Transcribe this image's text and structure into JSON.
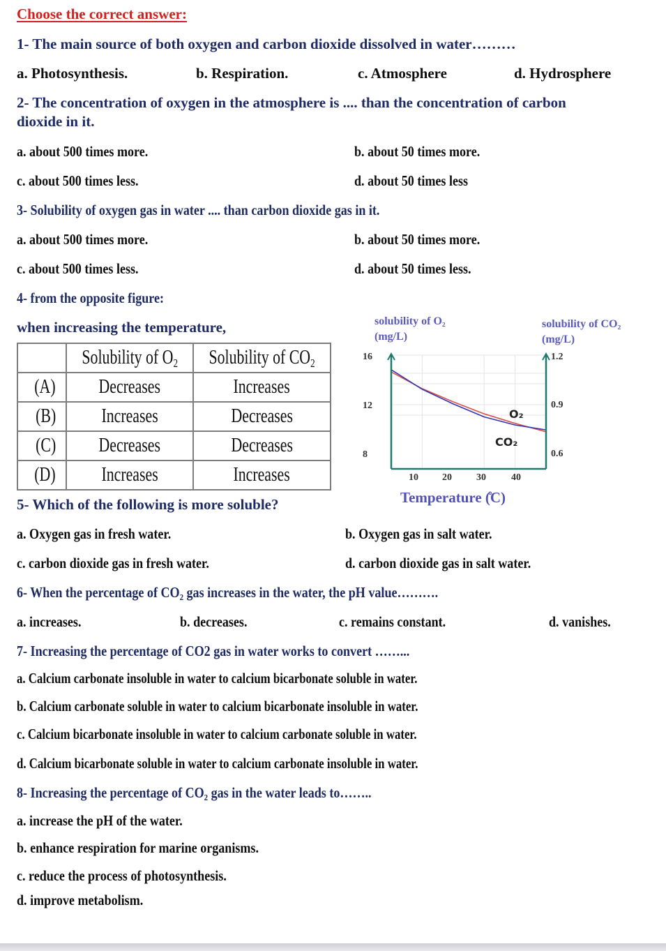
{
  "title": "Choose the correct answer:",
  "questions": [
    {
      "stem": "1- The main source of both oxygen and carbon dioxide dissolved in water………",
      "options": [
        "a. Photosynthesis.",
        "b. Respiration.",
        "c. Atmosphere",
        "d. Hydrosphere"
      ]
    },
    {
      "stem_line1": "2- The concentration of oxygen in the atmosphere is .... than the concentration of carbon",
      "stem_line2": "dioxide in it.",
      "options": [
        "a. about 500 times more.",
        "b. about 50 times more.",
        "c. about 500 times less.",
        "d. about 50 times less"
      ]
    },
    {
      "stem": "3- Solubility of oxygen gas in water .... than carbon dioxide gas in it.",
      "options": [
        "a. about 500 times more.",
        "b. about 50 times more.",
        "c. about 500 times less.",
        "d. about 50 times less."
      ]
    },
    {
      "stem": "4-  from the opposite figure:",
      "sub_stem": "when increasing the temperature,",
      "table": {
        "headers": [
          "",
          "Solubility of O",
          "Solubility of CO"
        ],
        "header_subscript": "2",
        "rows": [
          [
            "(A)",
            "Decreases",
            "Increases"
          ],
          [
            "(B)",
            "Increases",
            "Decreases"
          ],
          [
            "(C)",
            "Decreases",
            "Decreases"
          ],
          [
            "(D)",
            "Increases",
            "Increases"
          ]
        ]
      }
    },
    {
      "stem": "5- Which of the following is more soluble?",
      "options": [
        "a. Oxygen gas in fresh water.",
        "b. Oxygen gas in salt water.",
        "c. carbon dioxide gas in fresh water.",
        "d. carbon dioxide gas in salt water."
      ]
    },
    {
      "stem": "6- When the percentage of CO₂ gas increases in the water, the pH value……….",
      "options": [
        "a. increases.",
        "b. decreases.",
        "c. remains constant.",
        "d. vanishes."
      ]
    },
    {
      "stem": "7- Increasing the percentage of CO2 gas in water works to convert ……...",
      "options": [
        "a. Calcium carbonate insoluble in water to calcium bicarbonate soluble in water.",
        "b. Calcium carbonate soluble in water to calcium bicarbonate insoluble in water.",
        "c. Calcium bicarbonate insoluble in water to calcium carbonate soluble in water.",
        "d. Calcium bicarbonate soluble in water to calcium carbonate insoluble in water."
      ]
    },
    {
      "stem": "8-  Increasing the percentage of CO₂ gas in the water leads to……..",
      "options": [
        "a. increase the pH of the water.",
        "b. enhance respiration for marine organisms.",
        "c. reduce the process of photosynthesis.",
        "d. improve metabolism."
      ]
    }
  ],
  "chart_data": {
    "type": "line",
    "title": "",
    "xlabel": "Temperature (̊C)",
    "ylabel_left_line1": "solubility of O₂",
    "ylabel_left_line2": "(mg/L)",
    "ylabel_right_line1": "solubility of CO₂",
    "ylabel_right_line2": "(mg/L)",
    "x_ticks": [
      "10",
      "20",
      "30",
      "40"
    ],
    "y_left_ticks": [
      "16",
      "12",
      "8"
    ],
    "y_right_ticks": [
      "1.2",
      "0.9",
      "0.6"
    ],
    "xlim": [
      0,
      50
    ],
    "ylim_left": [
      6.5,
      16
    ],
    "ylim_right": [
      0.5,
      1.2
    ],
    "grid": true,
    "series": [
      {
        "name": "O₂",
        "axis": "left",
        "color": "#d9534a",
        "x": [
          0,
          10,
          20,
          30,
          40,
          50
        ],
        "y": [
          14.6,
          13.2,
          12.1,
          11.1,
          10.3,
          9.6
        ]
      },
      {
        "name": "CO₂",
        "axis": "right",
        "color": "#3535b0",
        "x": [
          0,
          10,
          20,
          30,
          40,
          50
        ],
        "y": [
          1.11,
          0.99,
          0.9,
          0.82,
          0.77,
          0.74
        ]
      }
    ],
    "series_labels": [
      "O₂",
      "CO₂"
    ],
    "axis_color": "#1f7a6e"
  }
}
